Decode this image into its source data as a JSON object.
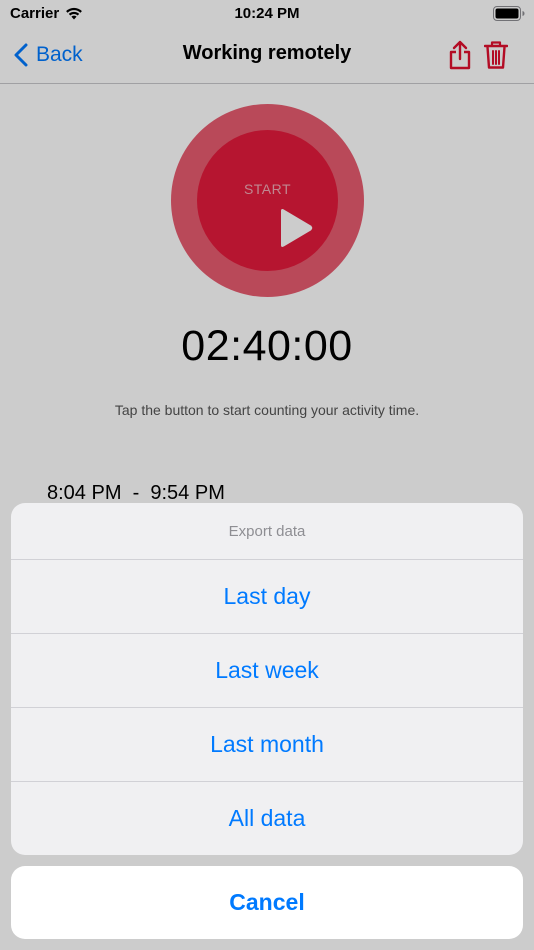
{
  "status_bar": {
    "carrier": "Carrier",
    "time": "10:24 PM",
    "icons": [
      "wifi-icon",
      "battery-icon"
    ]
  },
  "nav": {
    "back_label": "Back",
    "title": "Working remotely",
    "icons": [
      "chevron-left-icon",
      "share-icon",
      "trash-icon"
    ]
  },
  "timer": {
    "start_label": "START",
    "elapsed": "02:40:00",
    "hint": "Tap the button to start counting your activity time."
  },
  "entries": [
    {
      "text": "8:04 PM  -  9:54 PM"
    }
  ],
  "action_sheet": {
    "title": "Export data",
    "options": [
      {
        "label": "Last day"
      },
      {
        "label": "Last week"
      },
      {
        "label": "Last month"
      },
      {
        "label": "All data"
      }
    ],
    "cancel_label": "Cancel"
  },
  "colors": {
    "accent": "#007aff",
    "brand_red": "#e41b3c",
    "brand_red_ring": "#e85c70",
    "icon_red": "#e0102f"
  }
}
